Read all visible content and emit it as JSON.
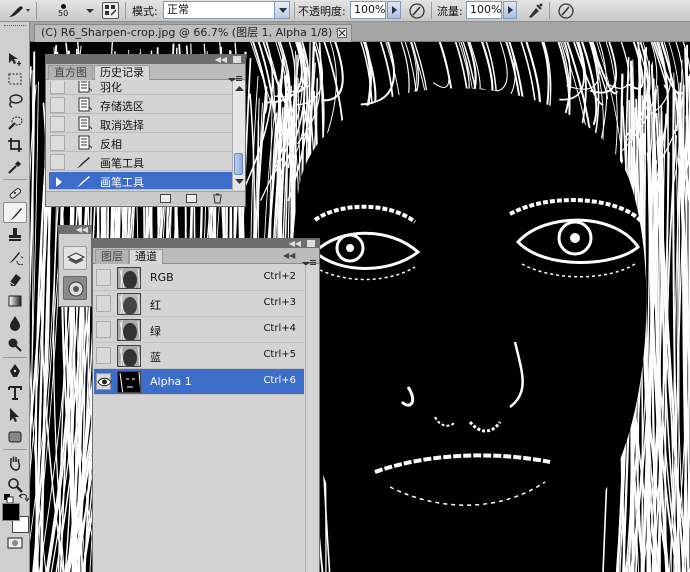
{
  "options_bar": {
    "brush_size": "50",
    "mode_label": "模式:",
    "mode_value": "正常",
    "opacity_label": "不透明度:",
    "opacity_value": "100%",
    "flow_label": "流量:",
    "flow_value": "100%"
  },
  "document": {
    "tab_title": "(C) R6_Sharpen-crop.jpg @ 66.7% (图层 1, Alpha 1/8) *"
  },
  "history_panel": {
    "tabs": [
      {
        "label": "直方图",
        "active": false
      },
      {
        "label": "历史记录",
        "active": true
      }
    ],
    "items": [
      {
        "label": "羽化",
        "icon": "document-step-icon",
        "selected": false
      },
      {
        "label": "存储选区",
        "icon": "document-step-icon",
        "selected": false
      },
      {
        "label": "取消选择",
        "icon": "document-step-icon",
        "selected": false
      },
      {
        "label": "反相",
        "icon": "document-step-icon",
        "selected": false
      },
      {
        "label": "画笔工具",
        "icon": "brush-icon",
        "selected": false
      },
      {
        "label": "画笔工具",
        "icon": "brush-icon",
        "selected": true
      }
    ]
  },
  "channels_panel": {
    "tabs": [
      {
        "label": "图层",
        "active": false
      },
      {
        "label": "通道",
        "active": true
      }
    ],
    "channels": [
      {
        "label": "RGB",
        "shortcut": "Ctrl+2",
        "visible": false,
        "selected": false
      },
      {
        "label": "红",
        "shortcut": "Ctrl+3",
        "visible": false,
        "selected": false
      },
      {
        "label": "绿",
        "shortcut": "Ctrl+4",
        "visible": false,
        "selected": false
      },
      {
        "label": "蓝",
        "shortcut": "Ctrl+5",
        "visible": false,
        "selected": false
      },
      {
        "label": "Alpha 1",
        "shortcut": "Ctrl+6",
        "visible": true,
        "selected": true
      }
    ]
  },
  "colors": {
    "selection": "#3c6dc9",
    "foreground": "#000000",
    "background": "#ffffff"
  }
}
